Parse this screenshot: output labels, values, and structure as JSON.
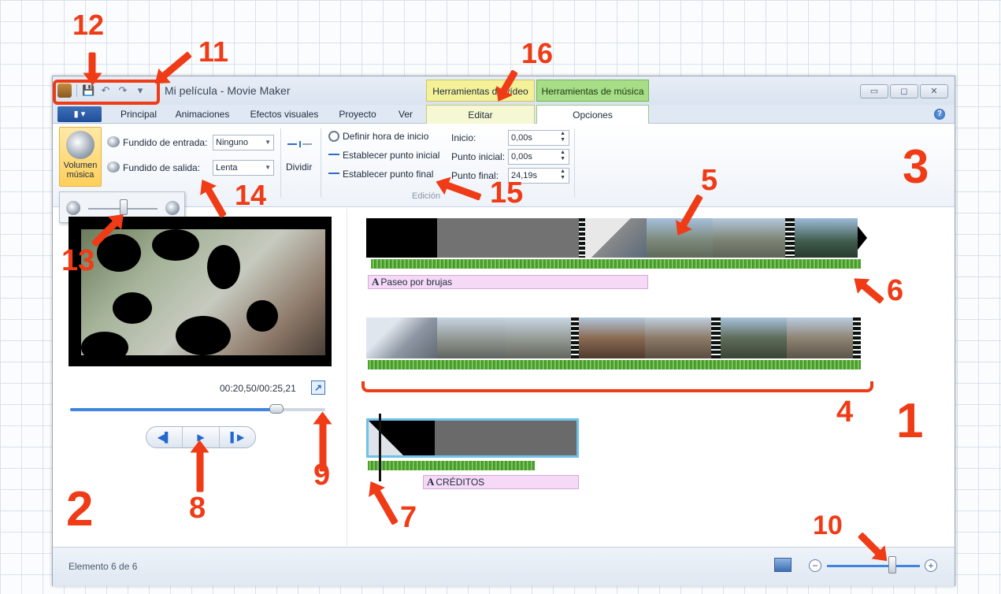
{
  "window": {
    "title": "Mi película - Movie Maker",
    "context_video": "Herramientas de vídeo",
    "context_music": "Herramientas de música",
    "buttons": {
      "minimize": "▭",
      "maximize": "◻",
      "close": "✕"
    }
  },
  "qat": {
    "save": "💾",
    "undo": "↶",
    "redo": "↷",
    "more": "▾"
  },
  "tabs": {
    "file": "▮ ▾",
    "items": [
      {
        "label": "Principal"
      },
      {
        "label": "Animaciones"
      },
      {
        "label": "Efectos visuales"
      },
      {
        "label": "Proyecto"
      },
      {
        "label": "Ver"
      },
      {
        "label": "Editar"
      },
      {
        "label": "Opciones"
      }
    ],
    "help": "?"
  },
  "ribbon": {
    "volume_label": "Volumen música",
    "fade_in_label": "Fundido de entrada:",
    "fade_in_value": "Ninguno",
    "fade_out_label": "Fundido de salida:",
    "fade_out_value": "Lenta",
    "split_label": "Dividir",
    "set_start_time": "Definir hora de inicio",
    "set_start_point": "Establecer punto inicial",
    "set_end_point": "Establecer punto final",
    "start_label": "Inicio:",
    "start_value": "0,00s",
    "start_point_label": "Punto inicial:",
    "start_point_value": "0,00s",
    "end_point_label": "Punto final:",
    "end_point_value": "24,19s",
    "group_edit": "Edición"
  },
  "player": {
    "time": "00:20,50/00:25,21",
    "seek_position_pct": 81,
    "prev": "◀▌",
    "play": "▶",
    "next": "▌▶"
  },
  "storyboard": {
    "caption_1": "Paseo por brujas",
    "caption_2": "CRÉDITOS",
    "caption_icon": "A"
  },
  "status": {
    "text": "Elemento 6 de 6",
    "zoom_minus": "−",
    "zoom_plus": "+",
    "zoom_level_pct": 70
  },
  "annotations": {
    "n1": "1",
    "n2": "2",
    "n3": "3",
    "n4": "4",
    "n5": "5",
    "n6": "6",
    "n7": "7",
    "n8": "8",
    "n9": "9",
    "n10": "10",
    "n11": "11",
    "n12": "12",
    "n13": "13",
    "n14": "14",
    "n15": "15",
    "n16": "16",
    "color": "#ef3b16"
  }
}
